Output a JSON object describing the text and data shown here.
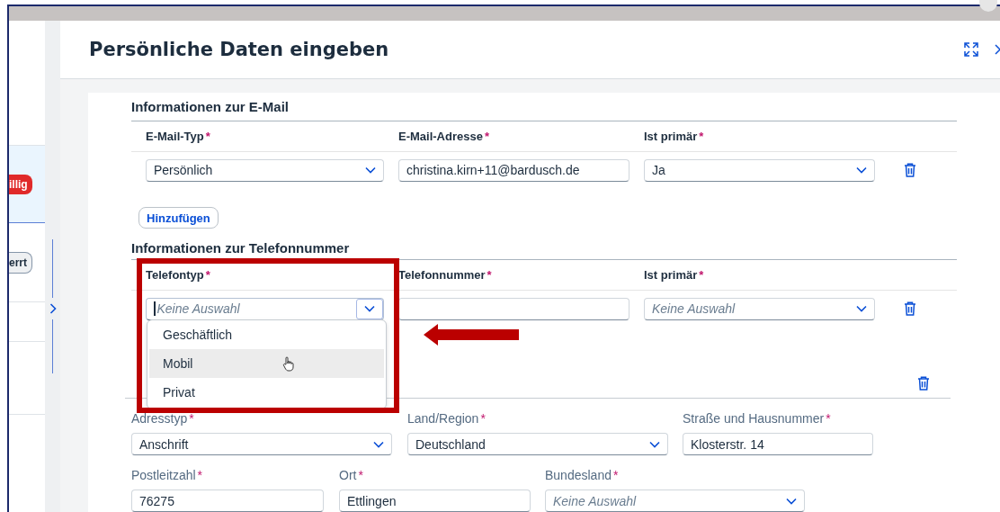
{
  "left_pane": {
    "badges": [
      {
        "label": "illig",
        "kind": "negative"
      },
      {
        "label": "errt",
        "kind": "neutral"
      }
    ]
  },
  "dialog": {
    "title": "Persönliche Daten eingeben"
  },
  "email_section": {
    "title": "Informationen zur E-Mail",
    "columns": [
      {
        "label": "E-Mail-Typ",
        "required_mark": "*"
      },
      {
        "label": "E-Mail-Adresse",
        "required_mark": "*"
      },
      {
        "label": "Ist primär",
        "required_mark": "*"
      }
    ],
    "rows": [
      {
        "cells": [
          {
            "kind": "select",
            "value": "Persönlich"
          },
          {
            "kind": "input",
            "value": "christina.kirn+11@bardusch.de"
          },
          {
            "kind": "select",
            "value": "Ja"
          }
        ]
      }
    ],
    "add_button": "Hinzufügen"
  },
  "phone_section": {
    "title": "Informationen zur Telefonnummer",
    "columns": [
      {
        "label": "Telefontyp",
        "required_mark": "*"
      },
      {
        "label": "Telefonnummer",
        "required_mark": "*"
      },
      {
        "label": "Ist primär",
        "required_mark": "*"
      }
    ],
    "rows": [
      {
        "cells": [
          {
            "kind": "combobox",
            "placeholder": "Keine Auswahl",
            "focused": true
          },
          {
            "kind": "input"
          },
          {
            "kind": "select",
            "placeholder": "Keine Auswahl"
          }
        ]
      }
    ]
  },
  "dropdown": {
    "options": [
      {
        "label": "Geschäftlich",
        "hovered": false
      },
      {
        "label": "Mobil",
        "hovered": true
      },
      {
        "label": "Privat",
        "hovered": false
      }
    ]
  },
  "address_section": {
    "rows": [
      {
        "fields": [
          {
            "label": "Adresstyp",
            "required_mark": "*",
            "kind": "select",
            "value": "Anschrift"
          },
          {
            "label": "Land/Region",
            "required_mark": "*",
            "kind": "select",
            "value": "Deutschland"
          },
          {
            "label": "Straße und Hausnummer",
            "required_mark": "*",
            "kind": "input",
            "value": "Klosterstr. 14"
          }
        ]
      },
      {
        "fields": [
          {
            "label": "Postleitzahl",
            "required_mark": "*",
            "kind": "input",
            "value": "76275"
          },
          {
            "label": "Ort",
            "required_mark": "*",
            "kind": "input",
            "value": "Ettlingen"
          },
          {
            "label": "Bundesland",
            "required_mark": "*",
            "kind": "select",
            "placeholder": "Keine Auswahl"
          }
        ]
      }
    ]
  }
}
